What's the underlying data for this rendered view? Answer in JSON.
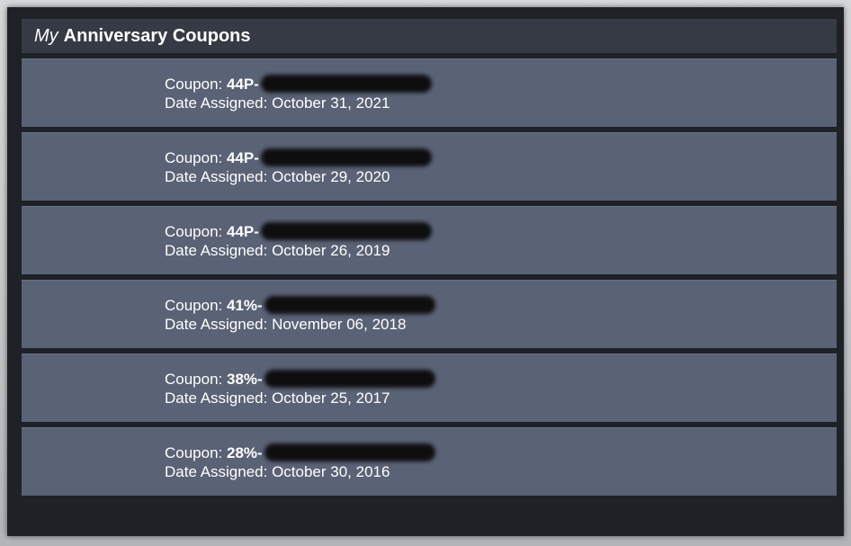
{
  "header": {
    "my": "My",
    "title": "Anniversary Coupons"
  },
  "labels": {
    "coupon": "Coupon: ",
    "date_assigned": "Date Assigned: "
  },
  "coupons": [
    {
      "prefix": "44P-",
      "date": "October 31, 2021"
    },
    {
      "prefix": "44P-",
      "date": "October 29, 2020"
    },
    {
      "prefix": "44P-",
      "date": "October 26, 2019"
    },
    {
      "prefix": "41%-",
      "date": "November 06, 2018"
    },
    {
      "prefix": "38%-",
      "date": "October 25, 2017"
    },
    {
      "prefix": "28%-",
      "date": "October 30, 2016"
    }
  ]
}
